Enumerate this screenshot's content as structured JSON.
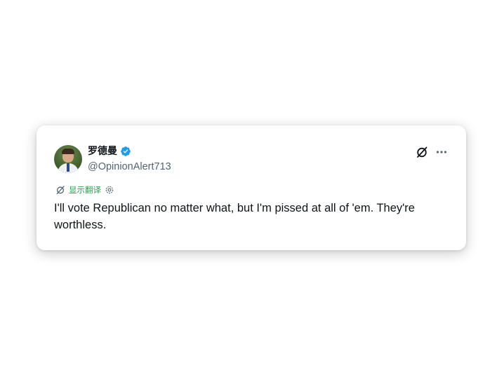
{
  "tweet": {
    "author_name": "罗德曼",
    "handle": "@OpinionAlert713",
    "verified": true,
    "translate_label": "显示翻译",
    "text": "I'll vote Republican no matter what, but I'm pissed at all of 'em. They're worthless."
  },
  "icons": {
    "verified": "verified-badge-icon",
    "grok": "grok-icon",
    "more": "more-options-icon",
    "translate": "translate-icon",
    "settings": "settings-gear-icon"
  },
  "colors": {
    "verified_blue": "#1d9bf0",
    "translate_green": "#2a9b4c",
    "text_primary": "#0f1419",
    "text_secondary": "#536471"
  }
}
